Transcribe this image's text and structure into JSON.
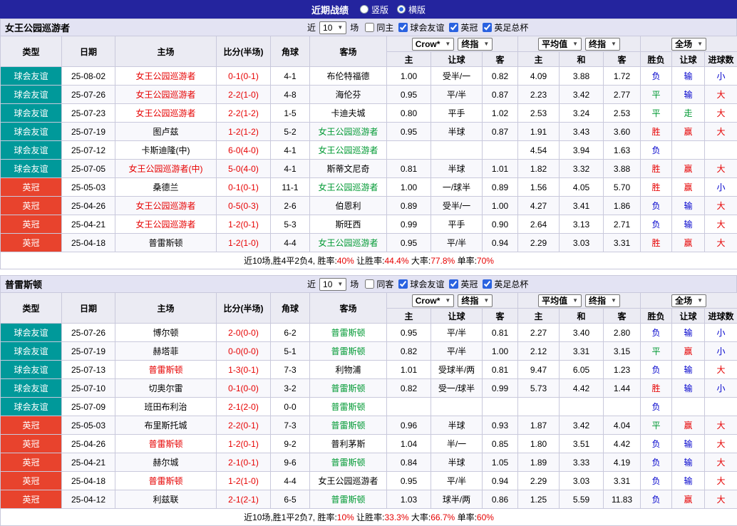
{
  "header": {
    "title": "近期战绩",
    "radios": [
      {
        "label": "竖版",
        "selected": false
      },
      {
        "label": "横版",
        "selected": true
      }
    ]
  },
  "labels": {
    "near": "近",
    "games": "场"
  },
  "columns": {
    "type": "类型",
    "date": "日期",
    "home": "主场",
    "score": "比分(半场)",
    "corner": "角球",
    "away": "客场",
    "group1": [
      "Crow*",
      "终指"
    ],
    "group2": [
      "平均值",
      "终指"
    ],
    "group3": [
      "全场"
    ],
    "sub": [
      "主",
      "让球",
      "客",
      "主",
      "和",
      "客",
      "胜负",
      "让球",
      "进球数"
    ]
  },
  "theme": {
    "topbar_bg": "#24249e",
    "section_head_bg": "#e3e3f3",
    "table_head_bg": "#ebebf3",
    "border": "#c9c9dc",
    "alt_row_bg": "#f8f8fc"
  },
  "colors": {
    "league": {
      "球会友谊": "#00999a",
      "英冠": "#e8432d"
    },
    "result": {
      "胜": "red",
      "平": "green",
      "负": "blue",
      "赢": "red",
      "走": "green",
      "输": "blue",
      "大": "red",
      "小": "blue"
    },
    "red": "#e60000",
    "green": "#009933",
    "blue": "#0000cc",
    "self_home": "#e60000",
    "self_away": "#009933",
    "score": "#e60000",
    "summary_value": "#e60000"
  },
  "sections": [
    {
      "team": "女王公园巡游者",
      "filter": {
        "count": "10",
        "checkboxes": [
          {
            "label": "同主",
            "checked": false
          },
          {
            "label": "球会友谊",
            "checked": true
          },
          {
            "label": "英冠",
            "checked": true
          },
          {
            "label": "英足总杯",
            "checked": true
          }
        ]
      },
      "rows": [
        {
          "type": "球会友谊",
          "date": "25-08-02",
          "home": "女王公园巡游者",
          "self": "home",
          "score": "0-1(0-1)",
          "corner": "4-1",
          "away": "布伦特福德",
          "odds": [
            "1.00",
            "受半/一",
            "0.82"
          ],
          "avg": [
            "4.09",
            "3.88",
            "1.72"
          ],
          "results": [
            "负",
            "输",
            "小"
          ]
        },
        {
          "type": "球会友谊",
          "date": "25-07-26",
          "home": "女王公园巡游者",
          "self": "home",
          "score": "2-2(1-0)",
          "corner": "4-8",
          "away": "海伦芬",
          "odds": [
            "0.95",
            "平/半",
            "0.87"
          ],
          "avg": [
            "2.23",
            "3.42",
            "2.77"
          ],
          "results": [
            "平",
            "输",
            "大"
          ]
        },
        {
          "type": "球会友谊",
          "date": "25-07-23",
          "home": "女王公园巡游者",
          "self": "home",
          "score": "2-2(1-2)",
          "corner": "1-5",
          "away": "卡迪夫城",
          "odds": [
            "0.80",
            "平手",
            "1.02"
          ],
          "avg": [
            "2.53",
            "3.24",
            "2.53"
          ],
          "results": [
            "平",
            "走",
            "大"
          ]
        },
        {
          "type": "球会友谊",
          "date": "25-07-19",
          "home": "图卢兹",
          "self": "away",
          "score": "1-2(1-2)",
          "corner": "5-2",
          "away": "女王公园巡游者",
          "odds": [
            "0.95",
            "半球",
            "0.87"
          ],
          "avg": [
            "1.91",
            "3.43",
            "3.60"
          ],
          "results": [
            "胜",
            "赢",
            "大"
          ]
        },
        {
          "type": "球会友谊",
          "date": "25-07-12",
          "home": "卡斯迪隆(中)",
          "self": "away",
          "score": "6-0(4-0)",
          "corner": "4-1",
          "away": "女王公园巡游者",
          "odds": [
            "",
            "",
            ""
          ],
          "avg": [
            "4.54",
            "3.94",
            "1.63"
          ],
          "results": [
            "负",
            "",
            ""
          ]
        },
        {
          "type": "球会友谊",
          "date": "25-07-05",
          "home": "女王公园巡游者(中)",
          "self": "home",
          "score": "5-0(4-0)",
          "corner": "4-1",
          "away": "斯蒂文尼奇",
          "odds": [
            "0.81",
            "半球",
            "1.01"
          ],
          "avg": [
            "1.82",
            "3.32",
            "3.88"
          ],
          "results": [
            "胜",
            "赢",
            "大"
          ]
        },
        {
          "type": "英冠",
          "date": "25-05-03",
          "home": "桑德兰",
          "self": "away",
          "score": "0-1(0-1)",
          "corner": "11-1",
          "away": "女王公园巡游者",
          "odds": [
            "1.00",
            "一/球半",
            "0.89"
          ],
          "avg": [
            "1.56",
            "4.05",
            "5.70"
          ],
          "results": [
            "胜",
            "赢",
            "小"
          ]
        },
        {
          "type": "英冠",
          "date": "25-04-26",
          "home": "女王公园巡游者",
          "self": "home",
          "score": "0-5(0-3)",
          "corner": "2-6",
          "away": "伯恩利",
          "odds": [
            "0.89",
            "受半/一",
            "1.00"
          ],
          "avg": [
            "4.27",
            "3.41",
            "1.86"
          ],
          "results": [
            "负",
            "输",
            "大"
          ]
        },
        {
          "type": "英冠",
          "date": "25-04-21",
          "home": "女王公园巡游者",
          "self": "home",
          "score": "1-2(0-1)",
          "corner": "5-3",
          "away": "斯旺西",
          "odds": [
            "0.99",
            "平手",
            "0.90"
          ],
          "avg": [
            "2.64",
            "3.13",
            "2.71"
          ],
          "results": [
            "负",
            "输",
            "大"
          ]
        },
        {
          "type": "英冠",
          "date": "25-04-18",
          "home": "普雷斯顿",
          "self": "away",
          "score": "1-2(1-0)",
          "corner": "4-4",
          "away": "女王公园巡游者",
          "odds": [
            "0.95",
            "平/半",
            "0.94"
          ],
          "avg": [
            "2.29",
            "3.03",
            "3.31"
          ],
          "results": [
            "胜",
            "赢",
            "大"
          ]
        }
      ],
      "summary": [
        {
          "t": "近10场,胜4平2负4, 胜率:",
          "c": "n"
        },
        {
          "t": "40%",
          "c": "r"
        },
        {
          "t": " 让胜率:",
          "c": "n"
        },
        {
          "t": "44.4%",
          "c": "r"
        },
        {
          "t": " 大率:",
          "c": "n"
        },
        {
          "t": "77.8%",
          "c": "r"
        },
        {
          "t": " 单率:",
          "c": "n"
        },
        {
          "t": "70%",
          "c": "r"
        }
      ]
    },
    {
      "team": "普雷斯顿",
      "filter": {
        "count": "10",
        "checkboxes": [
          {
            "label": "同客",
            "checked": false
          },
          {
            "label": "球会友谊",
            "checked": true
          },
          {
            "label": "英冠",
            "checked": true
          },
          {
            "label": "英足总杯",
            "checked": true
          }
        ]
      },
      "rows": [
        {
          "type": "球会友谊",
          "date": "25-07-26",
          "home": "博尔顿",
          "self": "away",
          "score": "2-0(0-0)",
          "corner": "6-2",
          "away": "普雷斯顿",
          "odds": [
            "0.95",
            "平/半",
            "0.81"
          ],
          "avg": [
            "2.27",
            "3.40",
            "2.80"
          ],
          "results": [
            "负",
            "输",
            "小"
          ]
        },
        {
          "type": "球会友谊",
          "date": "25-07-19",
          "home": "赫塔菲",
          "self": "away",
          "score": "0-0(0-0)",
          "corner": "5-1",
          "away": "普雷斯顿",
          "odds": [
            "0.82",
            "平/半",
            "1.00"
          ],
          "avg": [
            "2.12",
            "3.31",
            "3.15"
          ],
          "results": [
            "平",
            "赢",
            "小"
          ]
        },
        {
          "type": "球会友谊",
          "date": "25-07-13",
          "home": "普雷斯顿",
          "self": "home",
          "score": "1-3(0-1)",
          "corner": "7-3",
          "away": "利物浦",
          "odds": [
            "1.01",
            "受球半/两",
            "0.81"
          ],
          "avg": [
            "9.47",
            "6.05",
            "1.23"
          ],
          "results": [
            "负",
            "输",
            "大"
          ]
        },
        {
          "type": "球会友谊",
          "date": "25-07-10",
          "home": "切奥尔雷",
          "self": "away",
          "score": "0-1(0-0)",
          "corner": "3-2",
          "away": "普雷斯顿",
          "odds": [
            "0.82",
            "受一/球半",
            "0.99"
          ],
          "avg": [
            "5.73",
            "4.42",
            "1.44"
          ],
          "results": [
            "胜",
            "输",
            "小"
          ]
        },
        {
          "type": "球会友谊",
          "date": "25-07-09",
          "home": "班田布利治",
          "self": "away",
          "score": "2-1(2-0)",
          "corner": "0-0",
          "away": "普雷斯顿",
          "odds": [
            "",
            "",
            ""
          ],
          "avg": [
            "",
            "",
            ""
          ],
          "results": [
            "负",
            "",
            ""
          ]
        },
        {
          "type": "英冠",
          "date": "25-05-03",
          "home": "布里斯托城",
          "self": "away",
          "score": "2-2(0-1)",
          "corner": "7-3",
          "away": "普雷斯顿",
          "odds": [
            "0.96",
            "半球",
            "0.93"
          ],
          "avg": [
            "1.87",
            "3.42",
            "4.04"
          ],
          "results": [
            "平",
            "赢",
            "大"
          ]
        },
        {
          "type": "英冠",
          "date": "25-04-26",
          "home": "普雷斯顿",
          "self": "home",
          "score": "1-2(0-1)",
          "corner": "9-2",
          "away": "普利茅斯",
          "odds": [
            "1.04",
            "半/一",
            "0.85"
          ],
          "avg": [
            "1.80",
            "3.51",
            "4.42"
          ],
          "results": [
            "负",
            "输",
            "大"
          ]
        },
        {
          "type": "英冠",
          "date": "25-04-21",
          "home": "赫尔城",
          "self": "away",
          "score": "2-1(0-1)",
          "corner": "9-6",
          "away": "普雷斯顿",
          "odds": [
            "0.84",
            "半球",
            "1.05"
          ],
          "avg": [
            "1.89",
            "3.33",
            "4.19"
          ],
          "results": [
            "负",
            "输",
            "大"
          ]
        },
        {
          "type": "英冠",
          "date": "25-04-18",
          "home": "普雷斯顿",
          "self": "home",
          "score": "1-2(1-0)",
          "corner": "4-4",
          "away": "女王公园巡游者",
          "odds": [
            "0.95",
            "平/半",
            "0.94"
          ],
          "avg": [
            "2.29",
            "3.03",
            "3.31"
          ],
          "results": [
            "负",
            "输",
            "大"
          ]
        },
        {
          "type": "英冠",
          "date": "25-04-12",
          "home": "利兹联",
          "self": "away",
          "score": "2-1(2-1)",
          "corner": "6-5",
          "away": "普雷斯顿",
          "odds": [
            "1.03",
            "球半/两",
            "0.86"
          ],
          "avg": [
            "1.25",
            "5.59",
            "11.83"
          ],
          "results": [
            "负",
            "赢",
            "大"
          ]
        }
      ],
      "summary": [
        {
          "t": "近10场,胜1平2负7, 胜率:",
          "c": "n"
        },
        {
          "t": "10%",
          "c": "r"
        },
        {
          "t": " 让胜率:",
          "c": "n"
        },
        {
          "t": "33.3%",
          "c": "r"
        },
        {
          "t": " 大率:",
          "c": "n"
        },
        {
          "t": "66.7%",
          "c": "r"
        },
        {
          "t": " 单率:",
          "c": "n"
        },
        {
          "t": "60%",
          "c": "r"
        }
      ]
    }
  ]
}
